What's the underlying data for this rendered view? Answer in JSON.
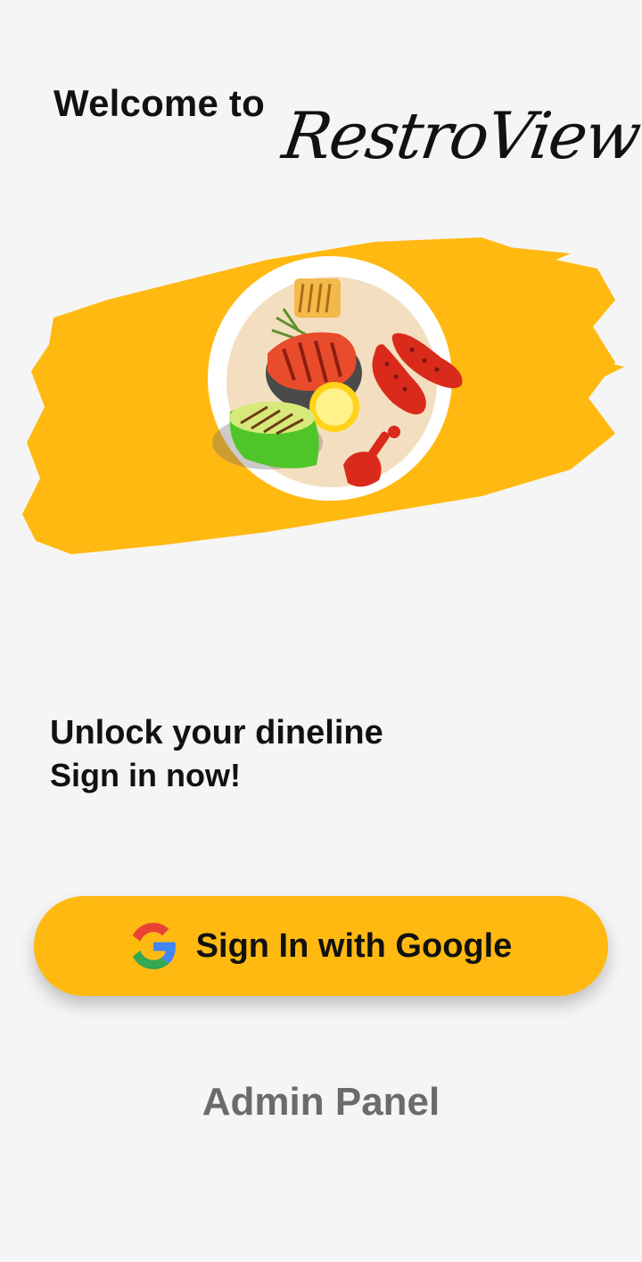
{
  "header": {
    "welcome": "Welcome to",
    "brand": "RestroView"
  },
  "hero": {
    "illustration": "grilled-food-plate-illustration",
    "brush_color": "#ffb911"
  },
  "tagline": {
    "line1": "Unlock your dineline",
    "line2": "Sign in now!"
  },
  "google_button": {
    "label": "Sign In with Google",
    "icon": "google-icon",
    "color": "#ffb911"
  },
  "admin_link": {
    "label": "Admin Panel"
  }
}
